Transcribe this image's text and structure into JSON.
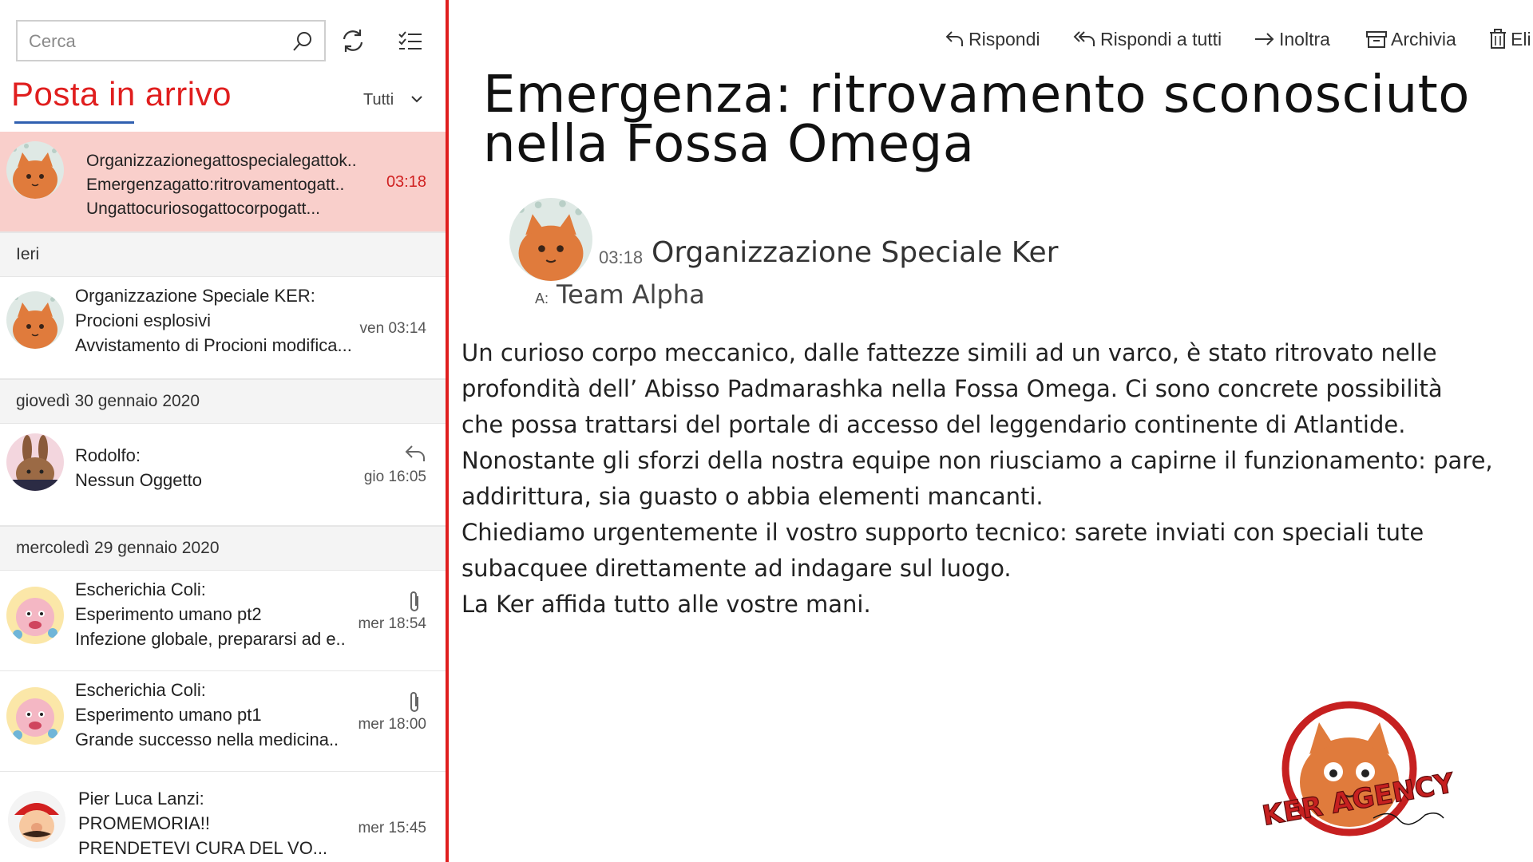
{
  "search": {
    "placeholder": "Cerca"
  },
  "inbox": {
    "title": "Posta in arrivo",
    "filter": "Tutti"
  },
  "mails": [
    {
      "line1": "Organizzazionegattospecialegattok..",
      "line2": "Emergenzagatto:ritrovamentogatt..",
      "line3": "Ungattocuriosogattocorpogatt...",
      "time": "03:18"
    },
    {
      "line1": "Organizzazione Speciale KER:",
      "line2": "Procioni esplosivi",
      "line3": "Avvistamento di Procioni modifica...",
      "time": "ven 03:14"
    },
    {
      "line1": "Rodolfo:",
      "line2": "Nessun Oggetto",
      "time": "gio 16:05"
    },
    {
      "line1": "Escherichia Coli:",
      "line2": "Esperimento umano pt2",
      "line3": "Infezione globale, prepararsi ad e..",
      "time": "mer 18:54"
    },
    {
      "line1": "Escherichia Coli:",
      "line2": "Esperimento umano pt1",
      "line3": "Grande successo nella medicina..",
      "time": "mer 18:00"
    },
    {
      "line1": "Pier Luca Lanzi:",
      "line2": "PROMEMORIA!!",
      "line3": "PRENDETEVI CURA DEL VO...",
      "time": "mer 15:45"
    }
  ],
  "groups": [
    "Ieri",
    "giovedì 30 gennaio 2020",
    "mercoledì 29 gennaio 2020"
  ],
  "toolbar": {
    "reply": "Rispondi",
    "reply_all": "Rispondi a tutti",
    "forward": "Inoltra",
    "archive": "Archivia",
    "delete": "Eli"
  },
  "message": {
    "subject": "Emergenza: ritrovamento sconosciuto nella Fossa Omega",
    "time": "03:18",
    "sender": "Organizzazione Speciale Ker",
    "to_label": "A:",
    "to": "Team Alpha",
    "body": [
      "Un curioso corpo meccanico, dalle fattezze simili ad un varco, è stato ritrovato nelle",
      "profondità dell’  Abisso Padmarashka  nella Fossa Omega. Ci sono concrete possibilità",
      "che possa trattarsi del portale di accesso del leggendario continente di Atlantide.",
      "Nonostante gli sforzi della nostra equipe non riusciamo a capirne il funzionamento: pare,",
      "addirittura, sia guasto o abbia elementi mancanti.",
      "Chiediamo urgentemente il vostro supporto tecnico: sarete inviati con speciali tute",
      "subacquee direttamente ad indagare sul luogo.",
      "La Ker affida tutto alle vostre mani."
    ]
  },
  "logo": {
    "text": "KER AGENCY"
  },
  "colors": {
    "accent": "#e01e1e",
    "selected_bg": "#f9cfcb",
    "underline": "#3060b0"
  }
}
